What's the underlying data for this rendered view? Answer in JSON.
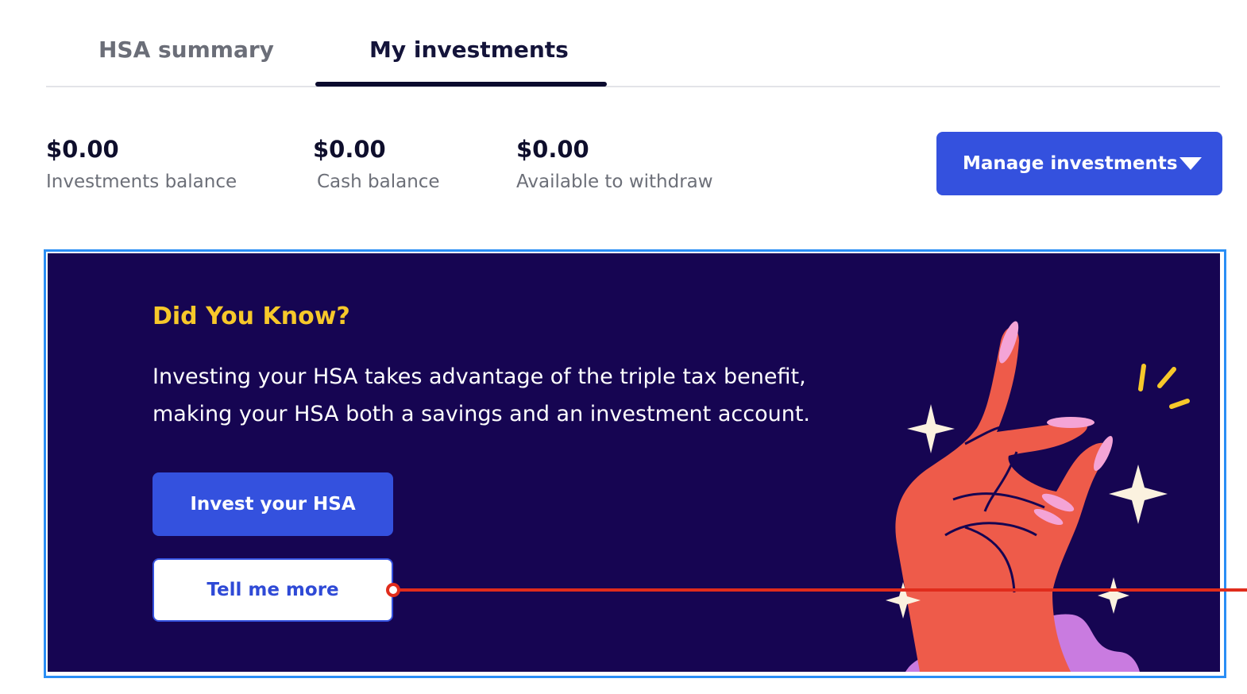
{
  "tabs": [
    {
      "label": "HSA summary",
      "active": false
    },
    {
      "label": "My investments",
      "active": true
    }
  ],
  "balances": {
    "investments": {
      "amount": "$0.00",
      "label": "Investments balance"
    },
    "cash": {
      "amount": "$0.00",
      "label": "Cash balance"
    },
    "withdraw": {
      "amount": "$0.00",
      "label": "Available to withdraw"
    }
  },
  "manage": {
    "label": "Manage investments",
    "icon": "caret-down-icon"
  },
  "promo": {
    "heading": "Did You Know?",
    "body": "Investing your HSA takes advantage of the triple tax benefit, making your HSA both a savings and an investment account.",
    "primary_button": "Invest your HSA",
    "secondary_button": "Tell me more",
    "illustration": "hand-snap-illustration"
  },
  "colors": {
    "accent": "#3451de",
    "promo_background": "#160552",
    "heading_yellow": "#f7c82a",
    "annotation_red": "#e02c1c",
    "focus_outline": "#2a8ef5"
  }
}
